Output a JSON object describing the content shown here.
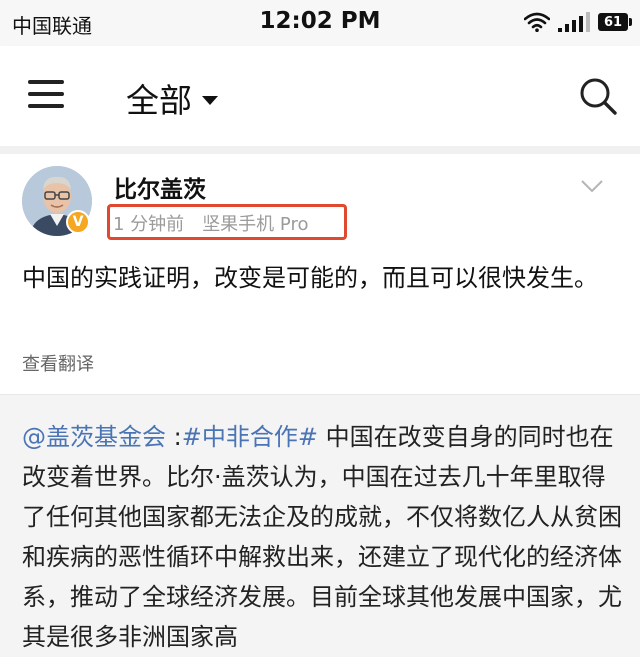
{
  "status_bar": {
    "carrier": "中国联通",
    "time": "12:02 PM",
    "battery": "61"
  },
  "nav": {
    "title": "全部"
  },
  "post": {
    "author": "比尔盖茨",
    "time_ago": "1 分钟前",
    "device": "坚果手机 Pro",
    "content": "中国的实践证明，改变是可能的，而且可以很快发生。",
    "translate_label": "查看翻译"
  },
  "repost": {
    "mention": "@盖茨基金会",
    "separator": " :",
    "hashtag": "#中非合作#",
    "content": " 中国在改变自身的同时也在改变着世界。比尔·盖茨认为，中国在过去几十年里取得了任何其他国家都无法企及的成就，不仅将数亿人从贫困和疾病的恶性循环中解救出来，还建立了现代化的经济体系，推动了全球经济发展。目前全球其他发展中国家，尤其是很多非洲国家高"
  },
  "colors": {
    "link": "#4a74b4",
    "highlight_border": "#e0482f",
    "verified": "#f5a623"
  }
}
